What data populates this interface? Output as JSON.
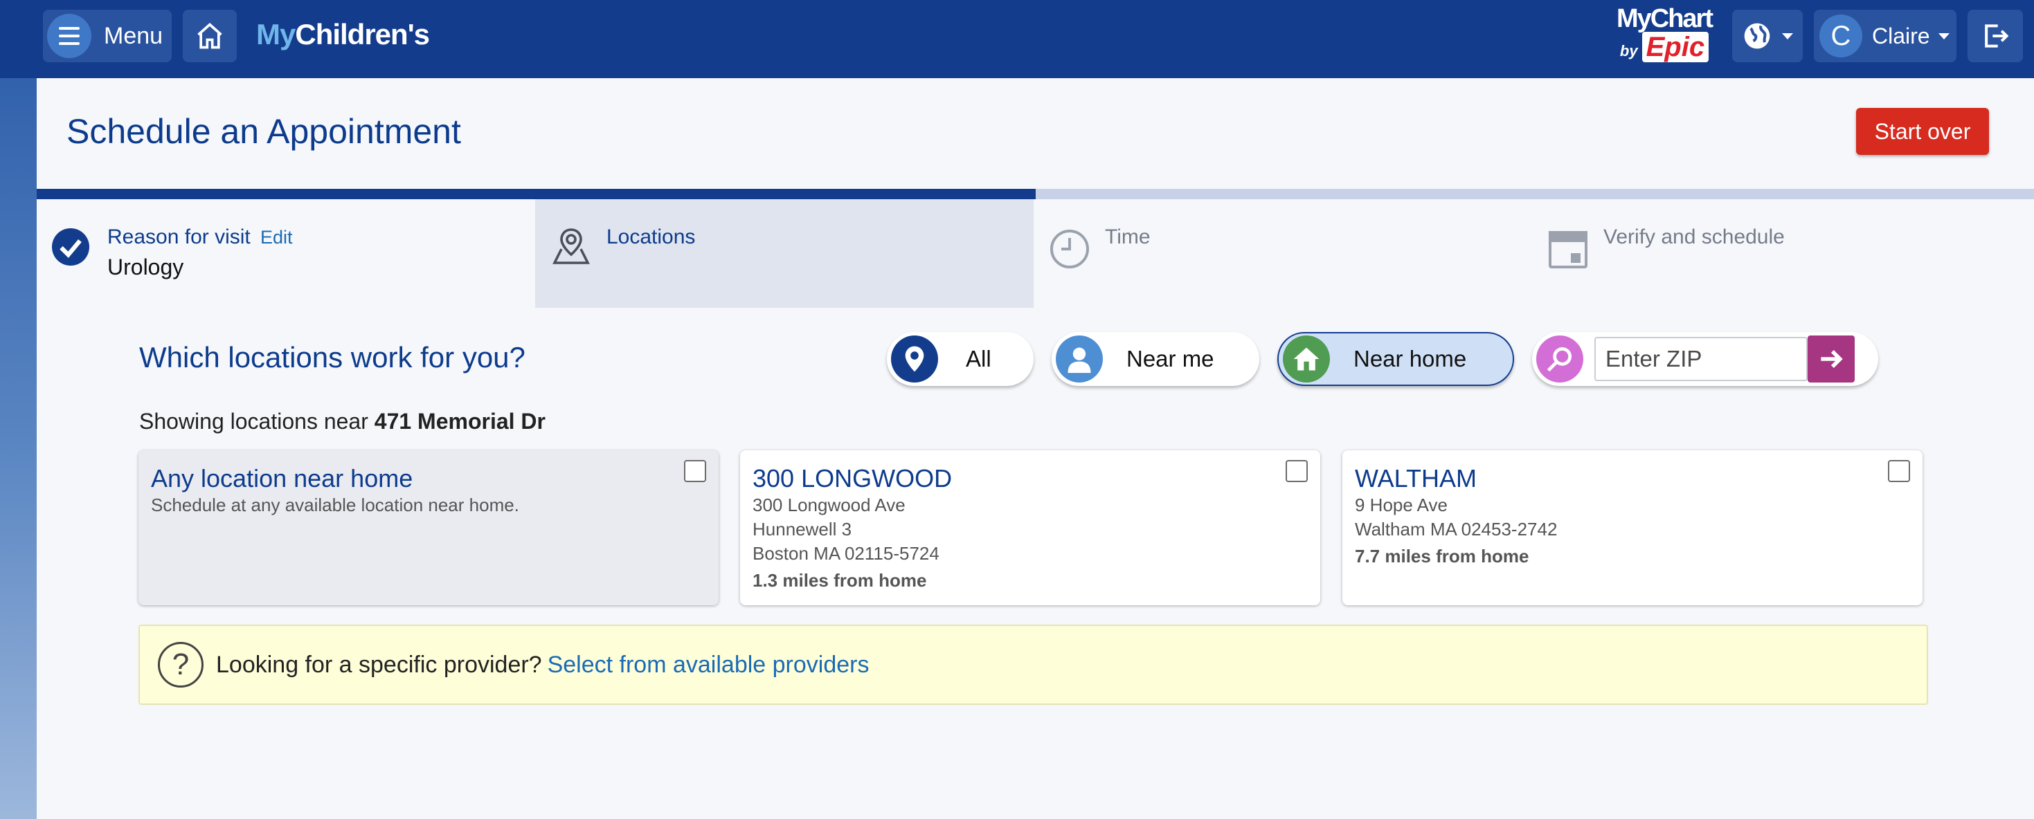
{
  "topbar": {
    "menu_label": "Menu",
    "brand_my": "My",
    "brand_children": "Children's",
    "mychart_line1": "MyChart",
    "mychart_by": "by",
    "mychart_epic": "Epic",
    "user_initial": "C",
    "user_name": "Claire",
    "bg_color": "#133c8c"
  },
  "header": {
    "title": "Schedule an Appointment",
    "start_over_label": "Start over",
    "progress_percent": 50
  },
  "steps": [
    {
      "label": "Reason for visit",
      "edit": "Edit",
      "value": "Urology",
      "state": "done"
    },
    {
      "label": "Locations",
      "state": "active"
    },
    {
      "label": "Time",
      "state": "pending"
    },
    {
      "label": "Verify and schedule",
      "state": "pending"
    }
  ],
  "locations": {
    "question": "Which locations work for you?",
    "filters": {
      "all": "All",
      "near_me": "Near me",
      "near_home": "Near home",
      "zip_placeholder": "Enter ZIP",
      "selected": "near_home"
    },
    "showing_prefix": "Showing locations near ",
    "showing_address": "471 Memorial Dr",
    "cards": [
      {
        "name": "Any location near home",
        "lines": [
          "Schedule at any available location near home."
        ],
        "distance": ""
      },
      {
        "name": "300 LONGWOOD",
        "lines": [
          "300 Longwood Ave",
          "Hunnewell 3",
          "Boston MA 02115-5724"
        ],
        "distance": "1.3 miles from home"
      },
      {
        "name": "WALTHAM",
        "lines": [
          "9 Hope Ave",
          "Waltham MA 02453-2742"
        ],
        "distance": "7.7 miles from home"
      }
    ]
  },
  "provider": {
    "question": "Looking for a specific provider?",
    "link": "Select from available providers"
  }
}
